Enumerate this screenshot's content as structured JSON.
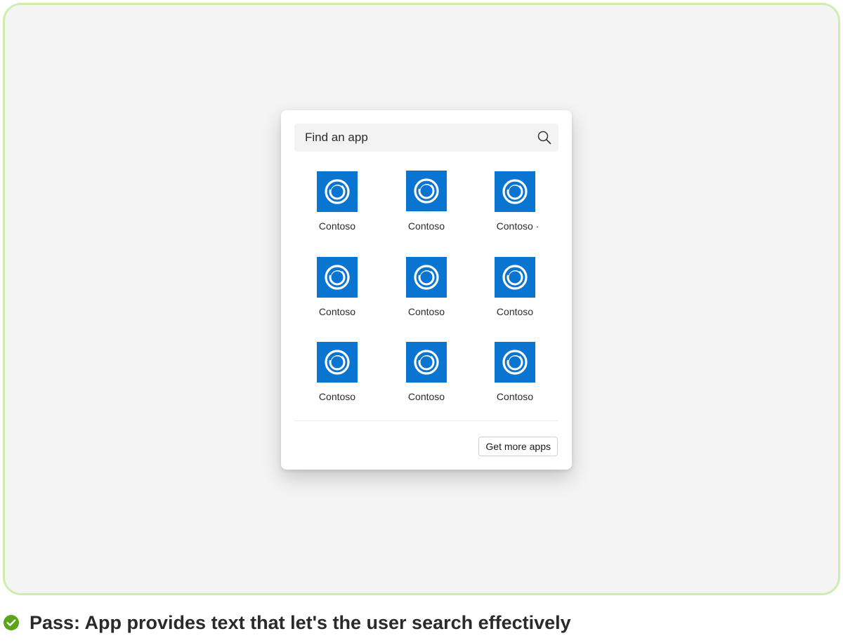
{
  "search": {
    "placeholder": "Find an app",
    "icon": "search-icon"
  },
  "apps": [
    {
      "label": "Contoso",
      "icon": "contoso-app-icon"
    },
    {
      "label": "Contoso",
      "icon": "contoso-app-icon"
    },
    {
      "label": "Contoso ·",
      "icon": "contoso-app-icon"
    },
    {
      "label": "Contoso",
      "icon": "contoso-app-icon"
    },
    {
      "label": "Contoso",
      "icon": "contoso-app-icon"
    },
    {
      "label": "Contoso",
      "icon": "contoso-app-icon"
    },
    {
      "label": "Contoso",
      "icon": "contoso-app-icon"
    },
    {
      "label": "Contoso",
      "icon": "contoso-app-icon"
    },
    {
      "label": "Contoso",
      "icon": "contoso-app-icon"
    }
  ],
  "footer": {
    "more_label": "Get more apps"
  },
  "caption": {
    "text": "Pass: App provides text that let's the user search effectively",
    "icon": "check-circle-icon"
  },
  "colors": {
    "app_icon_bg": "#0a75d1",
    "frame_border": "#cdeeb0",
    "pass_green": "#5aa618"
  }
}
